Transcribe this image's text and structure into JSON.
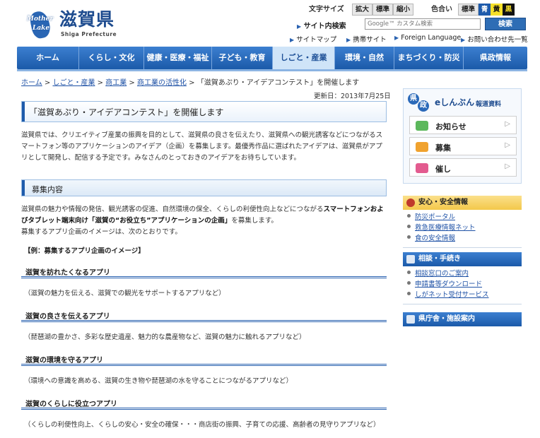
{
  "logo": {
    "mark_line1": "Mother",
    "mark_line2": "Lake",
    "name": "滋賀県",
    "sub": "Shiga Prefecture"
  },
  "text_size": {
    "label": "文字サイズ",
    "buttons": [
      "拡大",
      "標準",
      "縮小"
    ]
  },
  "color_scheme": {
    "label": "色合い",
    "standard": "標準",
    "options": [
      "青",
      "黄",
      "黒"
    ],
    "colors": {
      "blue": "#1e5bab",
      "yellow": "#f6e02a",
      "black": "#111111"
    }
  },
  "search": {
    "label": "サイト内検索",
    "placeholder": "Google™ カスタム検索",
    "button": "検索"
  },
  "util_links": [
    "サイトマップ",
    "携帯サイト",
    "Foreign Language",
    "お問い合わせ先一覧"
  ],
  "nav": {
    "items": [
      "ホーム",
      "くらし・文化",
      "健康・医療・福祉",
      "子ども・教育",
      "しごと・産業",
      "環境・自然",
      "まちづくり・防災",
      "県政情報"
    ],
    "active": "しごと・産業"
  },
  "breadcrumb": [
    "ホーム",
    "しごと・産業",
    "商工業",
    "商工業の活性化",
    "「滋賀あぷり・アイデアコンテスト」を開催します"
  ],
  "updated": "更新日：2013年7月25日",
  "page_title": "「滋賀あぷり・アイデアコンテスト」を開催します",
  "intro": "滋賀県では、クリエイティブ産業の振興を目的として、滋賀県の良さを伝えたり、滋賀県への観光誘客などにつながるスマートフォン等のアプリケーションのアイデア（企画）を募集します。最優秀作品に選ばれたアイデアは、滋賀県がアプリとして開発し、配信する予定です。みなさんのとっておきのアイデアをお待ちしています。",
  "section": {
    "heading": "募集内容",
    "p1_a": "滋賀県の魅力や情報の発信、観光誘客の促進、自然環境の保全、くらしの利便性向上などにつながる",
    "p1_b": "スマートフォンおよびタブレット端末向け「滋賀の“お役立ち”アプリケーションの企画」",
    "p1_c": "を募集します。",
    "p2": "募集するアプリ企画のイメージは、次のとおりです。",
    "example_head": "【例：募集するアプリ企画のイメージ】",
    "examples": [
      {
        "title": "滋賀を訪れたくなるアプリ",
        "note": "（滋賀の魅力を伝える、滋賀での観光をサポートするアプリなど）"
      },
      {
        "title": "滋賀の良さを伝えるアプリ",
        "note": "（琵琶湖の豊かさ、多彩な歴史遺産、魅力的な農産物など、滋賀の魅力に触れるアプリなど）"
      },
      {
        "title": "滋賀の環境を守るアプリ",
        "note": "（環境への意識を高める、滋賀の生き物や琵琶湖の水を守ることにつながるアプリなど）"
      },
      {
        "title": "滋賀のくらしに役立つアプリ",
        "note": "（くらしの利便性向上、くらしの安心・安全の確保・・・商店街の振興、子育ての応援、高齢者の見守りアプリなど）"
      }
    ]
  },
  "sidebar": {
    "news": {
      "ken": "県",
      "sei": "政",
      "title": "eしんぶん",
      "report": "報道資料",
      "buttons": [
        {
          "label": "お知らせ",
          "icon": "chat-bubble-icon"
        },
        {
          "label": "募集",
          "icon": "megaphone-icon"
        },
        {
          "label": "催し",
          "icon": "camera-icon"
        }
      ]
    },
    "safety": {
      "heading": "安心・安全情報",
      "links": [
        "防災ポータル",
        "救急医療情報ネット",
        "食の安全情報"
      ]
    },
    "consult": {
      "heading": "相談・手続き",
      "links": [
        "相談窓口のご案内",
        "申請書等ダウンロード",
        "しがネット受付サービス"
      ]
    },
    "facilities": {
      "heading": "県庁舎・施設案内"
    }
  }
}
